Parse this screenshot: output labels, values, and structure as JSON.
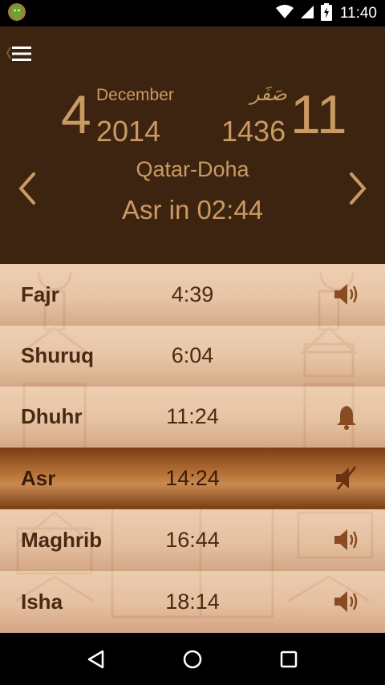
{
  "status_bar": {
    "time": "11:40",
    "icons": [
      "android-debug-icon",
      "wifi-icon",
      "signal-icon",
      "battery-charging-icon"
    ]
  },
  "header": {
    "menu_icon": "hamburger-menu-icon",
    "gregorian": {
      "day": "4",
      "month": "December",
      "year": "2014"
    },
    "hijri": {
      "day": "11",
      "month": "صَفَر",
      "year": "1436"
    },
    "location": "Qatar-Doha",
    "next_prayer": "Asr in 02:44",
    "prev_icon": "chevron-left-icon",
    "next_icon": "chevron-right-icon"
  },
  "prayers": [
    {
      "name": "Fajr",
      "time": "4:39",
      "alert": "speaker-icon",
      "active": false
    },
    {
      "name": "Shuruq",
      "time": "6:04",
      "alert": "none",
      "active": false
    },
    {
      "name": "Dhuhr",
      "time": "11:24",
      "alert": "bell-icon",
      "active": false
    },
    {
      "name": "Asr",
      "time": "14:24",
      "alert": "speaker-muted-icon",
      "active": true
    },
    {
      "name": "Maghrib",
      "time": "16:44",
      "alert": "speaker-icon",
      "active": false
    },
    {
      "name": "Isha",
      "time": "18:14",
      "alert": "speaker-icon",
      "active": false
    }
  ],
  "colors": {
    "header_bg": "#3d2410",
    "header_text": "#c99a62",
    "row_text": "#4a2912",
    "active_row": "#9a5a28"
  },
  "nav_bar": {
    "icons": [
      "back-triangle-icon",
      "home-circle-icon",
      "recents-square-icon"
    ]
  }
}
